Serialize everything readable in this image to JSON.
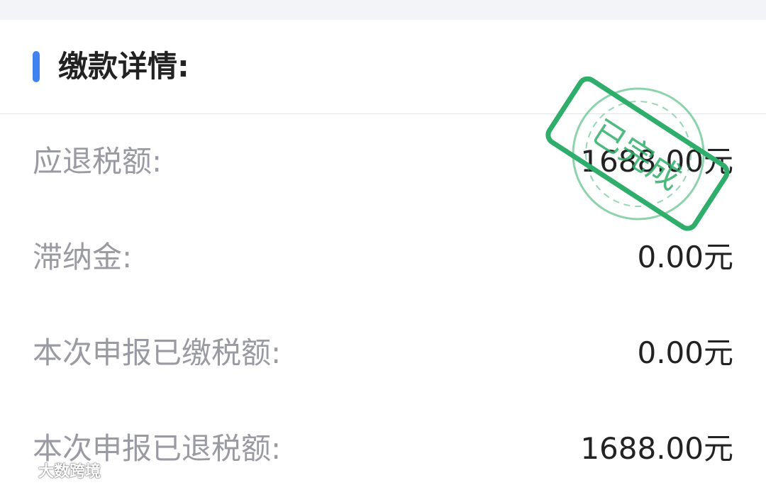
{
  "section": {
    "title": "缴款详情:",
    "accent_color": "#3f82f0"
  },
  "rows": [
    {
      "label": "应退税额:",
      "value": "1688.00元"
    },
    {
      "label": "滞纳金:",
      "value": "0.00元"
    },
    {
      "label": "本次申报已缴税额:",
      "value": "0.00元"
    },
    {
      "label": "本次申报已退税额:",
      "value": "1688.00元"
    }
  ],
  "stamp": {
    "text": "已完成",
    "color": "#2eae6a"
  },
  "watermark": {
    "text": "大数跨境",
    "icon": "logo-icon"
  }
}
